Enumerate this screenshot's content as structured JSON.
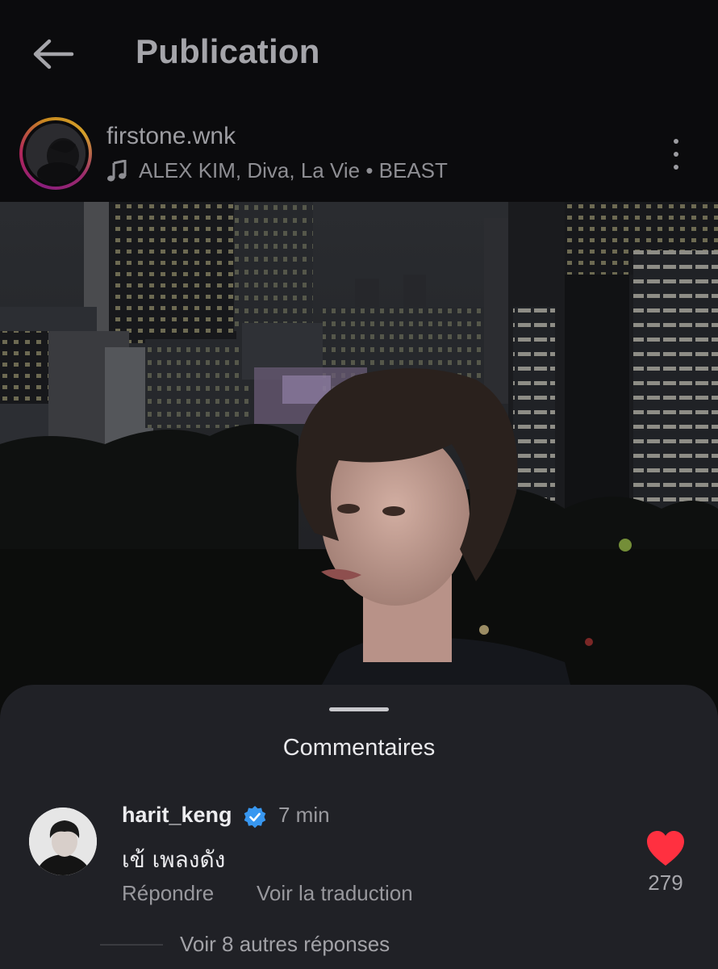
{
  "header": {
    "title": "Publication"
  },
  "post": {
    "username": "firstone.wnk",
    "music": "ALEX KIM, Diva, La Vie • BEAST"
  },
  "comments_sheet": {
    "title": "Commentaires",
    "comments": [
      {
        "username": "harit_keng",
        "verified": true,
        "time": "7 min",
        "text": "เข้ เพลงดัง",
        "reply_label": "Répondre",
        "translate_label": "Voir la traduction",
        "likes": "279",
        "more_replies_label": "Voir 8 autres réponses"
      }
    ]
  },
  "icons": {
    "back": "arrow-left-icon",
    "music": "music-note-icon",
    "more": "more-vertical-icon",
    "verified": "verified-badge-icon",
    "like": "heart-icon"
  },
  "colors": {
    "background": "#0b0b0d",
    "sheet": "#202126",
    "like": "#ff3040",
    "verified": "#3897f0"
  }
}
